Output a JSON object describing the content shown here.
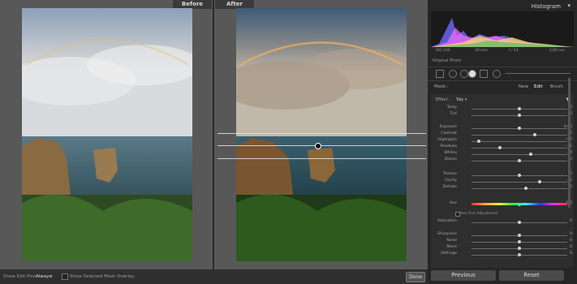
{
  "compare": {
    "before_label": "Before",
    "after_label": "After"
  },
  "bottom_bar": {
    "show_edit_pins_label": "Show Edit Pins :",
    "show_edit_pins_value": "Always",
    "show_mask_overlay_label": "Show Selected Mask Overlay",
    "done_label": "Done"
  },
  "panel": {
    "histogram_title": "Histogram",
    "exif": [
      "ISO 100",
      "20 mm",
      "f / 13",
      "1/20 sec"
    ],
    "original_photo_label": "Original Photo",
    "mask_label": "Mask :",
    "mask_tabs": [
      "New",
      "Edit",
      "Brush"
    ],
    "effect_label": "Effect :",
    "effect_value": "Sky",
    "rows": [
      {
        "label": "Temp",
        "value": "0",
        "pos": 0.5
      },
      {
        "label": "Tint",
        "value": "0",
        "pos": 0.5
      },
      {
        "label": "Exposure",
        "value": "0.00",
        "pos": 0.5
      },
      {
        "label": "Contrast",
        "value": "36",
        "pos": 0.66
      },
      {
        "label": "Highlights",
        "value": "- 87",
        "pos": 0.08
      },
      {
        "label": "Shadows",
        "value": "- 41",
        "pos": 0.3
      },
      {
        "label": "Whites",
        "value": "24",
        "pos": 0.62
      },
      {
        "label": "Blacks",
        "value": "0",
        "pos": 0.5
      },
      {
        "label": "Texture",
        "value": "0",
        "pos": 0.5
      },
      {
        "label": "Clarity",
        "value": "42",
        "pos": 0.71
      },
      {
        "label": "Dehaze",
        "value": "15",
        "pos": 0.57
      },
      {
        "label": "Hue",
        "value": "0.0",
        "pos": 0.5
      },
      {
        "label": "Saturation",
        "value": "0",
        "pos": 0.5
      },
      {
        "label": "Sharpness",
        "value": "0",
        "pos": 0.5
      },
      {
        "label": "Noise",
        "value": "0",
        "pos": 0.5
      },
      {
        "label": "Moiré",
        "value": "0",
        "pos": 0.5
      },
      {
        "label": "Defringe",
        "value": "0",
        "pos": 0.5
      }
    ],
    "fine_adjustment_label": "Use Fine Adjustment",
    "previous_label": "Previous",
    "reset_label": "Reset"
  }
}
